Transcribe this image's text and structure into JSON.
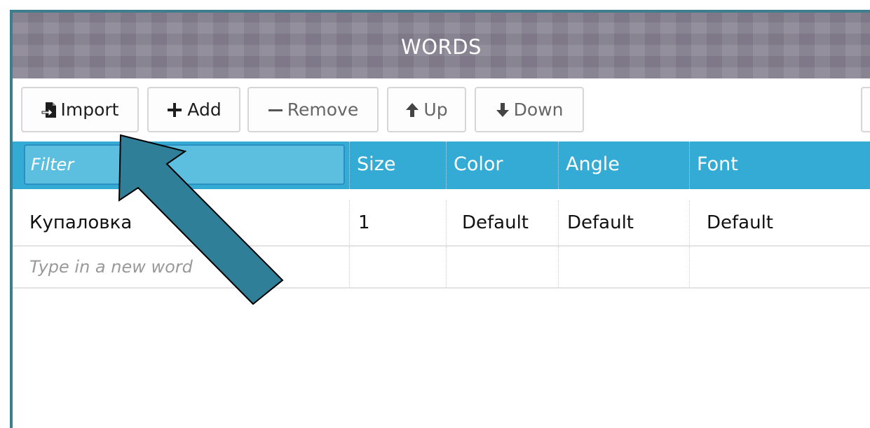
{
  "window": {
    "title": "WORDS"
  },
  "toolbar": {
    "import_label": "Import",
    "add_label": "Add",
    "remove_label": "Remove",
    "up_label": "Up",
    "down_label": "Down"
  },
  "grid": {
    "filter_placeholder": "Filter",
    "columns": {
      "size": "Size",
      "color": "Color",
      "angle": "Angle",
      "font": "Font"
    },
    "rows": [
      {
        "word": "Купаловка",
        "size": "1",
        "color": "Default",
        "angle": "Default",
        "font": "Default"
      }
    ],
    "new_word_placeholder": "Type in a new word"
  },
  "colors": {
    "header_blue": "#33abd4",
    "filter_blue": "#5dbfe0",
    "arrow_fill": "#2f7f98",
    "frame": "#3d7d8e"
  },
  "icons": {
    "import": "import-icon",
    "add": "plus-icon",
    "remove": "minus-icon",
    "up": "arrow-up-icon",
    "down": "arrow-down-icon"
  }
}
